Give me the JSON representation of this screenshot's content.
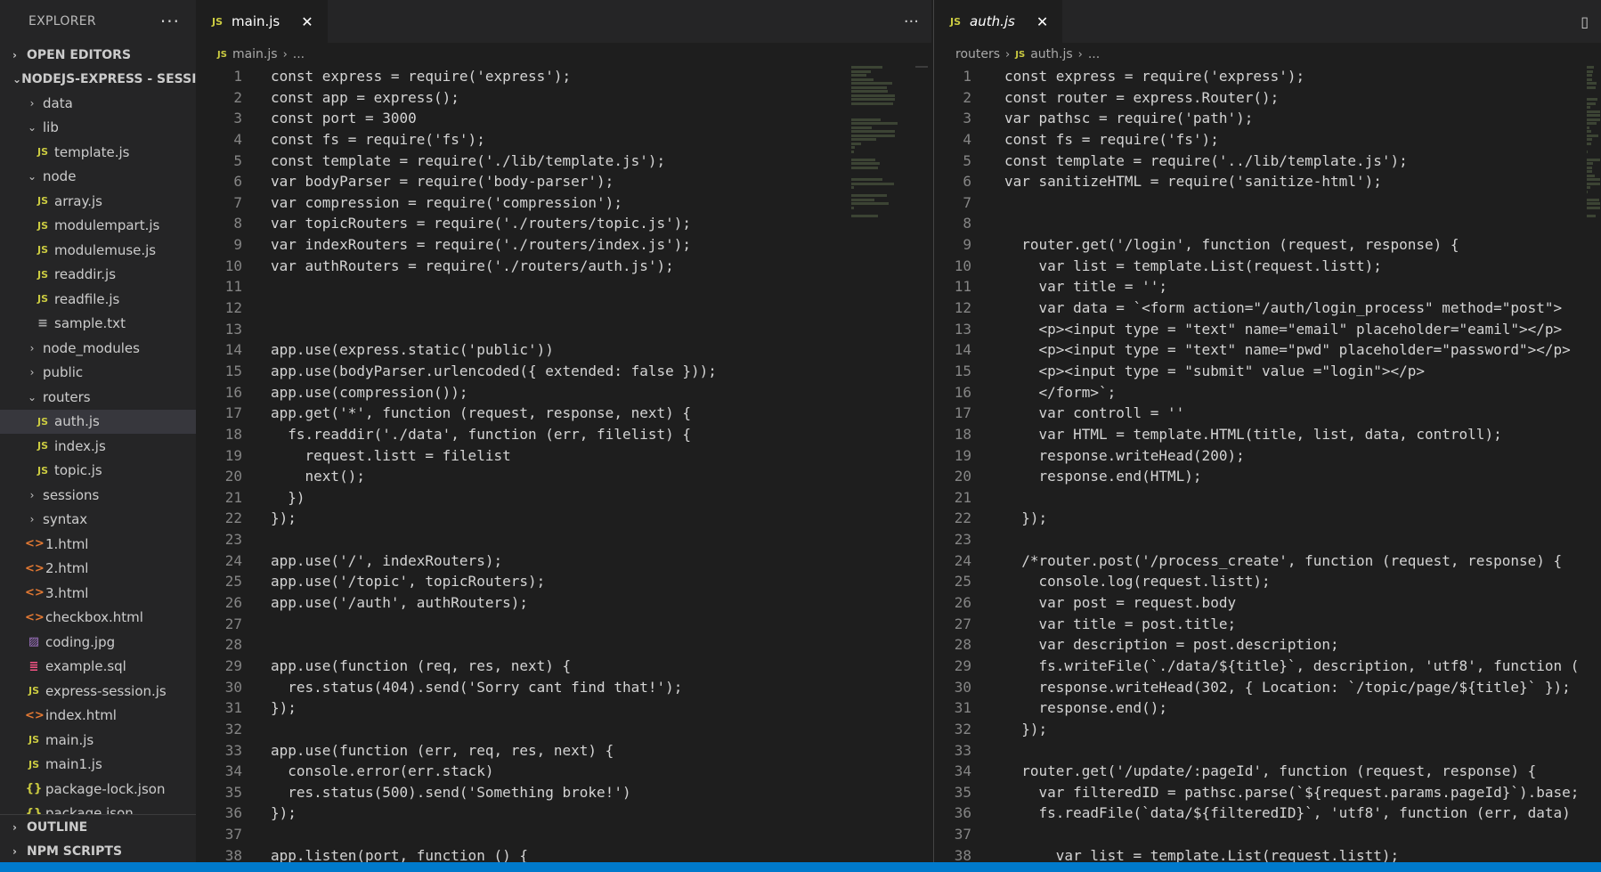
{
  "explorer": {
    "title": "EXPLORER",
    "more": "···",
    "sections": {
      "open_editors": "OPEN EDITORS",
      "project": "NODEJS-EXPRESS - SESSIO...",
      "outline": "OUTLINE",
      "npm_scripts": "NPM SCRIPTS"
    },
    "tree": [
      {
        "label": "data",
        "type": "folder",
        "open": false,
        "depth": 1
      },
      {
        "label": "lib",
        "type": "folder",
        "open": true,
        "depth": 1
      },
      {
        "label": "template.js",
        "type": "js",
        "depth": 2
      },
      {
        "label": "node",
        "type": "folder",
        "open": true,
        "depth": 1
      },
      {
        "label": "array.js",
        "type": "js",
        "depth": 2
      },
      {
        "label": "modulempart.js",
        "type": "js",
        "depth": 2
      },
      {
        "label": "modulemuse.js",
        "type": "js",
        "depth": 2
      },
      {
        "label": "readdir.js",
        "type": "js",
        "depth": 2
      },
      {
        "label": "readfile.js",
        "type": "js",
        "depth": 2
      },
      {
        "label": "sample.txt",
        "type": "txt",
        "depth": 2
      },
      {
        "label": "node_modules",
        "type": "folder",
        "open": false,
        "depth": 1
      },
      {
        "label": "public",
        "type": "folder",
        "open": false,
        "depth": 1
      },
      {
        "label": "routers",
        "type": "folder",
        "open": true,
        "depth": 1
      },
      {
        "label": "auth.js",
        "type": "js",
        "depth": 2,
        "selected": true
      },
      {
        "label": "index.js",
        "type": "js",
        "depth": 2
      },
      {
        "label": "topic.js",
        "type": "js",
        "depth": 2
      },
      {
        "label": "sessions",
        "type": "folder",
        "open": false,
        "depth": 1
      },
      {
        "label": "syntax",
        "type": "folder",
        "open": false,
        "depth": 1
      },
      {
        "label": "1.html",
        "type": "html",
        "depth": 1
      },
      {
        "label": "2.html",
        "type": "html",
        "depth": 1
      },
      {
        "label": "3.html",
        "type": "html",
        "depth": 1
      },
      {
        "label": "checkbox.html",
        "type": "html",
        "depth": 1
      },
      {
        "label": "coding.jpg",
        "type": "img",
        "depth": 1
      },
      {
        "label": "example.sql",
        "type": "sql",
        "depth": 1
      },
      {
        "label": "express-session.js",
        "type": "js",
        "depth": 1
      },
      {
        "label": "index.html",
        "type": "html",
        "depth": 1
      },
      {
        "label": "main.js",
        "type": "js",
        "depth": 1
      },
      {
        "label": "main1.js",
        "type": "js",
        "depth": 1
      },
      {
        "label": "package-lock.json",
        "type": "json",
        "depth": 1
      },
      {
        "label": "package.json",
        "type": "json",
        "depth": 1
      }
    ]
  },
  "icons": {
    "js": "JS",
    "folder_open": "⌄",
    "folder_closed": "›",
    "html": "<>",
    "txt": "≡",
    "img": "▨",
    "sql": "≣",
    "json": "{}"
  },
  "left_editor": {
    "tab_label": "main.js",
    "tab_icon": "JS",
    "close": "✕",
    "actions": "···",
    "breadcrumb": [
      "main.js",
      "..."
    ],
    "lines": [
      "const express = require('express');",
      "const app = express();",
      "const port = 3000",
      "const fs = require('fs');",
      "const template = require('./lib/template.js');",
      "var bodyParser = require('body-parser');",
      "var compression = require('compression');",
      "var topicRouters = require('./routers/topic.js');",
      "var indexRouters = require('./routers/index.js');",
      "var authRouters = require('./routers/auth.js');",
      "",
      "",
      "",
      "app.use(express.static('public'))",
      "app.use(bodyParser.urlencoded({ extended: false }));",
      "app.use(compression());",
      "app.get('*', function (request, response, next) {",
      "  fs.readdir('./data', function (err, filelist) {",
      "    request.listt = filelist",
      "    next();",
      "  })",
      "});",
      "",
      "app.use('/', indexRouters);",
      "app.use('/topic', topicRouters);",
      "app.use('/auth', authRouters);",
      "",
      "",
      "app.use(function (req, res, next) {",
      "  res.status(404).send('Sorry cant find that!');",
      "});",
      "",
      "app.use(function (err, req, res, next) {",
      "  console.error(err.stack)",
      "  res.status(500).send('Something broke!')",
      "});",
      "",
      "app.listen(port, function () {"
    ]
  },
  "right_editor": {
    "tab_label": "auth.js",
    "tab_icon": "JS",
    "close": "✕",
    "breadcrumb": [
      "routers",
      "auth.js",
      "..."
    ],
    "lines": [
      "const express = require('express');",
      "const router = express.Router();",
      "var pathsc = require('path');",
      "const fs = require('fs');",
      "const template = require('../lib/template.js');",
      "var sanitizeHTML = require('sanitize-html');",
      "",
      "",
      "  router.get('/login', function (request, response) {",
      "    var list = template.List(request.listt);",
      "    var title = '';",
      "    var data = `<form action=\"/auth/login_process\" method=\"post\">",
      "    <p><input type = \"text\" name=\"email\" placeholder=\"eamil\"></p>",
      "    <p><input type = \"text\" name=\"pwd\" placeholder=\"password\"></p>",
      "    <p><input type = \"submit\" value =\"login\"></p>",
      "    </form>`;",
      "    var controll = ''",
      "    var HTML = template.HTML(title, list, data, controll);",
      "    response.writeHead(200);",
      "    response.end(HTML);",
      "",
      "  });",
      "",
      "  /*router.post('/process_create', function (request, response) {",
      "    console.log(request.listt);",
      "    var post = request.body",
      "    var title = post.title;",
      "    var description = post.description;",
      "    fs.writeFile(`./data/${title}`, description, 'utf8', function (",
      "    response.writeHead(302, { Location: `/topic/page/${title}` });",
      "    response.end();",
      "  });",
      "",
      "  router.get('/update/:pageId', function (request, response) {",
      "    var filteredID = pathsc.parse(`${request.params.pageId}`).base;",
      "    fs.readFile(`data/${filteredID}`, 'utf8', function (err, data)",
      "",
      "      var list = template.List(request.listt);"
    ]
  }
}
